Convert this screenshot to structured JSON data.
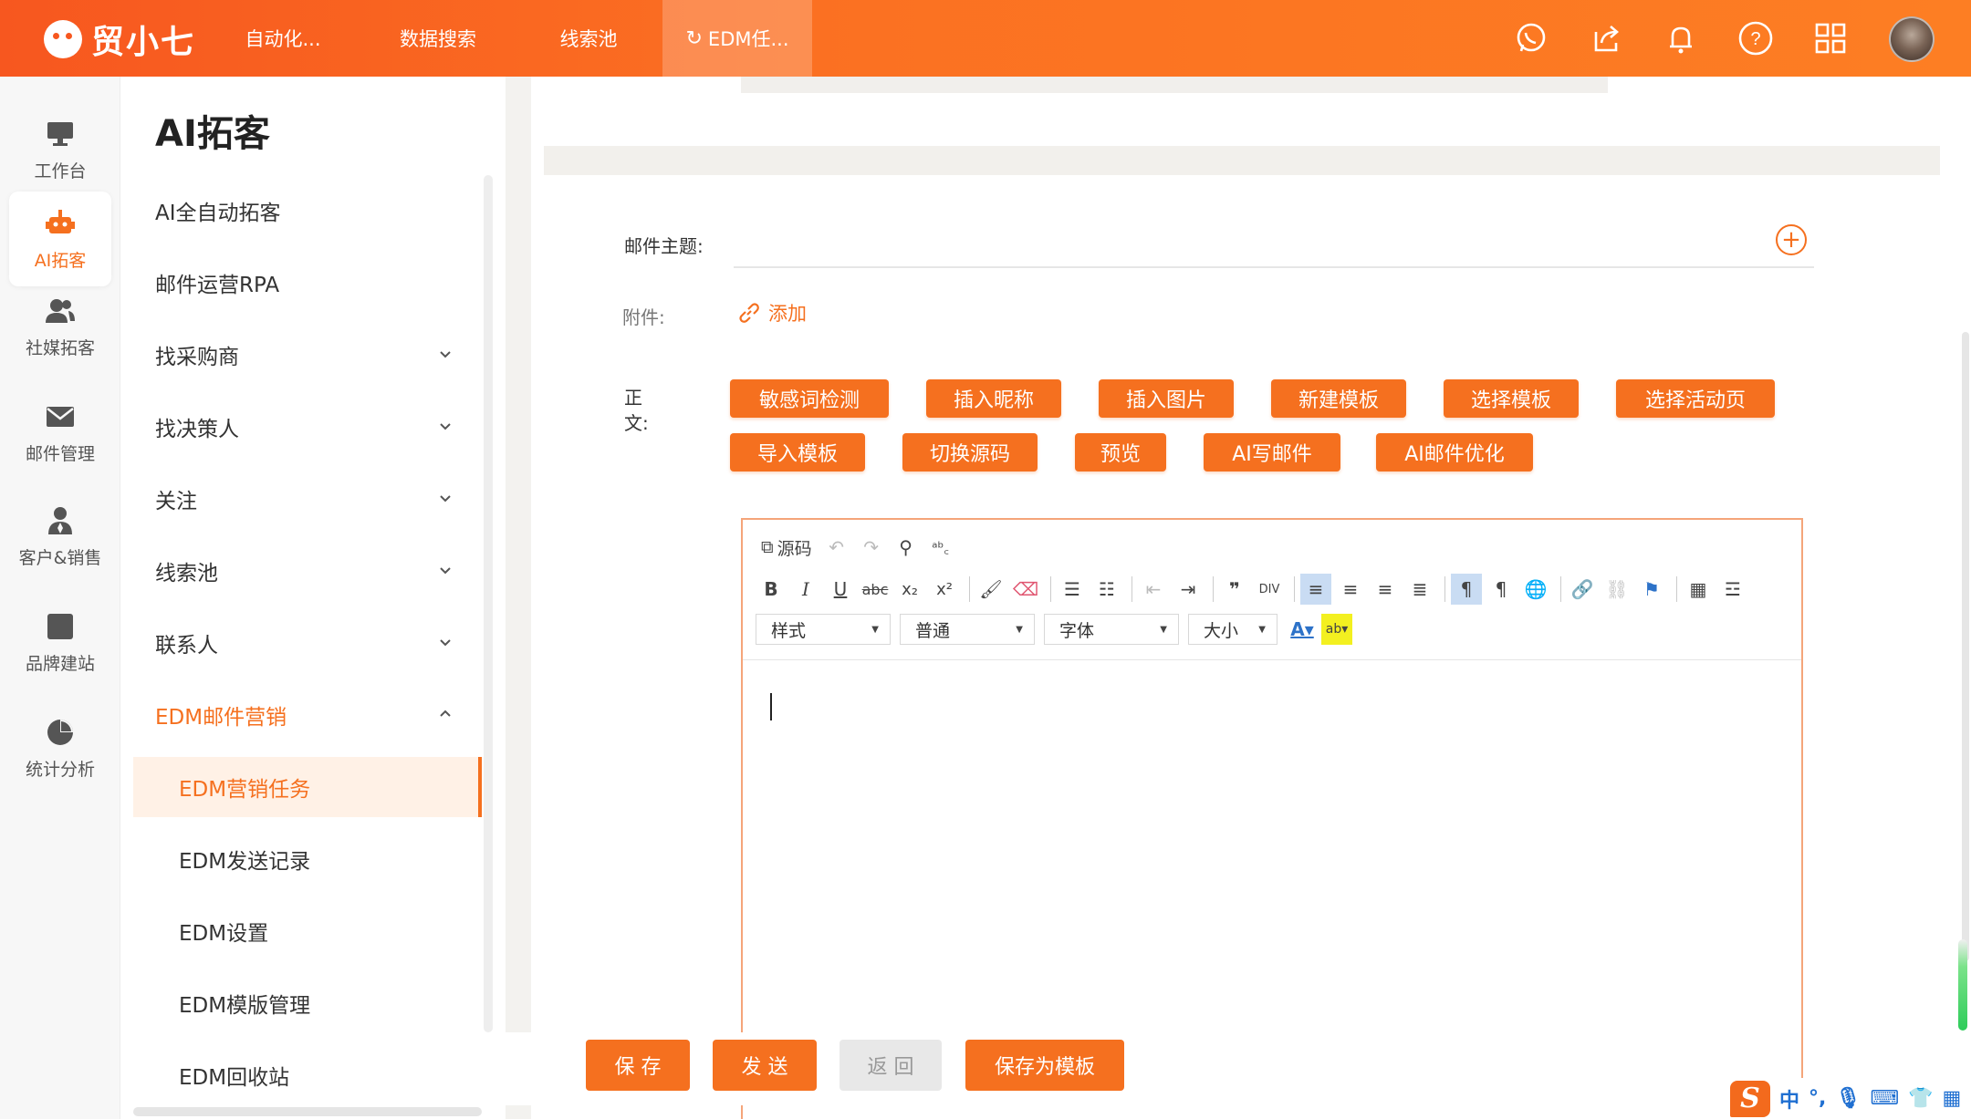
{
  "app": {
    "name": "贸小七"
  },
  "top_tabs": [
    {
      "label": "自动化..."
    },
    {
      "label": "数据搜索"
    },
    {
      "label": "线索池"
    },
    {
      "label": "EDM任..."
    }
  ],
  "top_icons": [
    "whatsapp-icon",
    "share-icon",
    "bell-icon",
    "help-icon",
    "apps-grid-icon",
    "user-avatar"
  ],
  "icon_nav": [
    {
      "label": "工作台",
      "icon": "monitor-icon"
    },
    {
      "label": "AI拓客",
      "icon": "robot-icon"
    },
    {
      "label": "社媒拓客",
      "icon": "users-icon"
    },
    {
      "label": "邮件管理",
      "icon": "mail-icon"
    },
    {
      "label": "客户&销售",
      "icon": "person-tie-icon"
    },
    {
      "label": "品牌建站",
      "icon": "square-icon"
    },
    {
      "label": "统计分析",
      "icon": "pie-icon"
    }
  ],
  "subnav": {
    "title": "AI拓客",
    "items": [
      {
        "label": "AI全自动拓客"
      },
      {
        "label": "邮件运营RPA"
      },
      {
        "label": "找采购商"
      },
      {
        "label": "找决策人"
      },
      {
        "label": "关注"
      },
      {
        "label": "线索池"
      },
      {
        "label": "联系人"
      },
      {
        "label": "EDM邮件营销"
      }
    ],
    "children": [
      {
        "label": "EDM营销任务"
      },
      {
        "label": "EDM发送记录"
      },
      {
        "label": "EDM设置"
      },
      {
        "label": "EDM模版管理"
      },
      {
        "label": "EDM回收站"
      }
    ]
  },
  "form": {
    "subject_label": "邮件主题:",
    "subject_value": "",
    "attachment_label": "附件:",
    "attachment_add": "添加",
    "body_label": "正文:"
  },
  "body_buttons": [
    {
      "label": "敏感词检测"
    },
    {
      "label": "插入昵称"
    },
    {
      "label": "插入图片"
    },
    {
      "label": "新建模板"
    },
    {
      "label": "选择模板"
    },
    {
      "label": "选择活动页"
    },
    {
      "label": "导入模板"
    },
    {
      "label": "切换源码"
    },
    {
      "label": "预览"
    },
    {
      "label": "AI写邮件"
    },
    {
      "label": "AI邮件优化"
    }
  ],
  "editor": {
    "source_label": "源码",
    "selects": [
      {
        "label": "样式"
      },
      {
        "label": "普通"
      },
      {
        "label": "字体"
      },
      {
        "label": "大小"
      }
    ],
    "content": ""
  },
  "bottom_buttons": [
    {
      "label": "保 存"
    },
    {
      "label": "发 送"
    },
    {
      "label": "返 回"
    },
    {
      "label": "保存为模板"
    }
  ],
  "ime": {
    "logo": "S",
    "mode": "中"
  },
  "colors": {
    "accent": "#f5701f",
    "topbar_start": "#f7571f",
    "active_bg": "#fff1e6",
    "disabled_bg": "#e8e8e8"
  }
}
